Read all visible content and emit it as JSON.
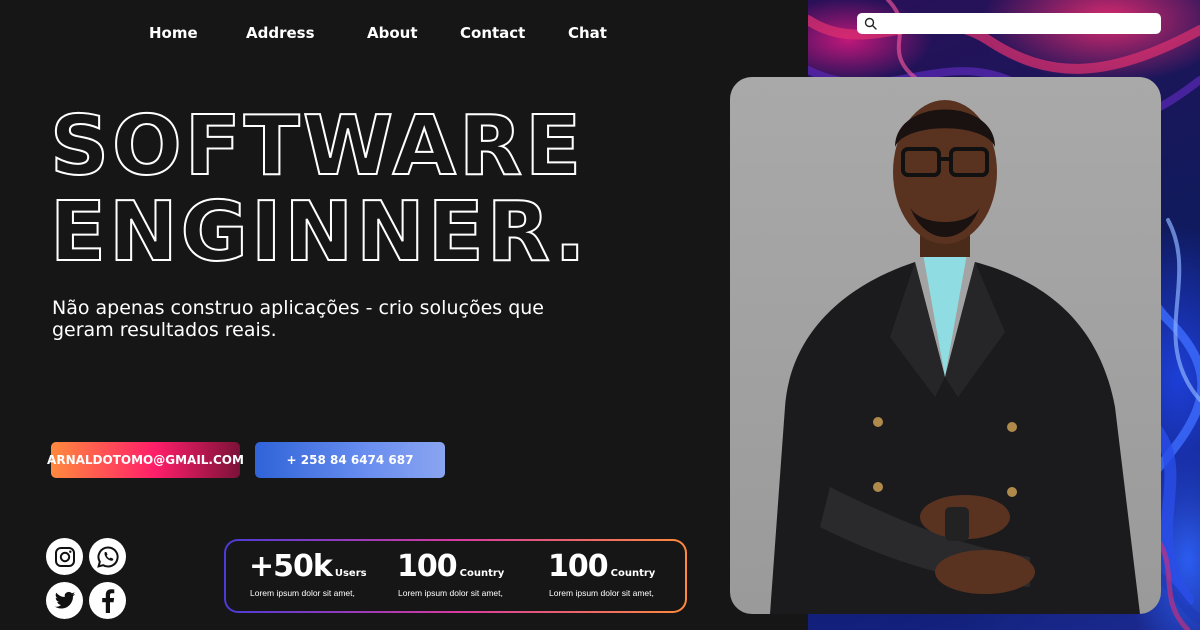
{
  "nav": {
    "items": [
      {
        "label": "Home"
      },
      {
        "label": "Address"
      },
      {
        "label": "About"
      },
      {
        "label": "Contact"
      },
      {
        "label": "Chat"
      }
    ]
  },
  "search": {
    "placeholder": "",
    "icon": "search-icon"
  },
  "hero": {
    "headline_line1": "SOFTWARE",
    "headline_line2": "ENGINNER.",
    "subtitle": "Não apenas construo aplicações - crio soluções que geram resultados reais."
  },
  "contact": {
    "email": "ARNALDOTOMO@GMAIL.COM",
    "phone": "+ 258 84 6474 687"
  },
  "social": [
    "instagram-icon",
    "whatsapp-icon",
    "twitter-icon",
    "facebook-icon"
  ],
  "stats": [
    {
      "value": "+50k",
      "unit": "Users",
      "desc": "Lorem ipsum dolor sit amet,"
    },
    {
      "value": "100",
      "unit": "Country",
      "desc": "Lorem ipsum dolor sit amet,"
    },
    {
      "value": "100",
      "unit": "Country",
      "desc": "Lorem ipsum dolor sit amet,"
    }
  ],
  "colors": {
    "background": "#161616",
    "email_gradient": [
      "#ff8a3d",
      "#ff1e6a"
    ],
    "phone_gradient": [
      "#2f63d8",
      "#8aa4f0"
    ],
    "stats_border": [
      "#4a3bd8",
      "#d63aa0",
      "#ff8a3d"
    ]
  }
}
